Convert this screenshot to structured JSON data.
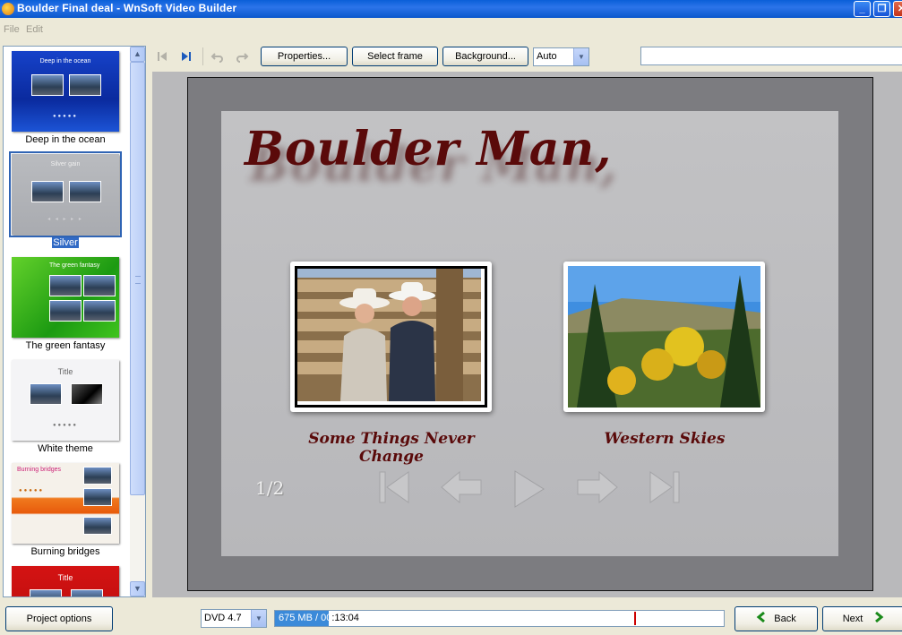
{
  "window": {
    "title": "Boulder Final deal - WnSoft Video Builder",
    "controls": {
      "minimize": "_",
      "maximize": "❐",
      "close": "✕"
    }
  },
  "menu": {
    "file": "File",
    "edit": "Edit"
  },
  "themes": [
    {
      "name": "Deep in the ocean",
      "thumb_title": "Deep in the ocean"
    },
    {
      "name": "Silver",
      "thumb_title": "Silver gain",
      "selected": true
    },
    {
      "name": "The green fantasy",
      "thumb_title": "The green fantasy"
    },
    {
      "name": "White theme",
      "thumb_title": "Title"
    },
    {
      "name": "Burning bridges",
      "thumb_title": "Burning bridges"
    },
    {
      "name": "",
      "thumb_title": "Title"
    }
  ],
  "toolbar": {
    "properties": "Properties...",
    "select_frame": "Select frame",
    "background": "Background...",
    "mode_value": "Auto",
    "search_value": ""
  },
  "preview": {
    "title": "Boulder Man,",
    "captions": [
      "Some Things Never Change",
      "Western Skies"
    ],
    "page_indicator": "1/2"
  },
  "status": {
    "project_options": "Project options",
    "disc_value": "DVD 4.7",
    "progress_fill": 0.12,
    "progress_marker": 0.8,
    "progress_text_filled": "675 MB / 00",
    "progress_text_rest": ":13:04",
    "back": "Back",
    "next": "Next"
  },
  "colors": {
    "title_text": "#5a0a0a",
    "selection": "#316ac5",
    "accent_blue": "#0a5fd8"
  }
}
